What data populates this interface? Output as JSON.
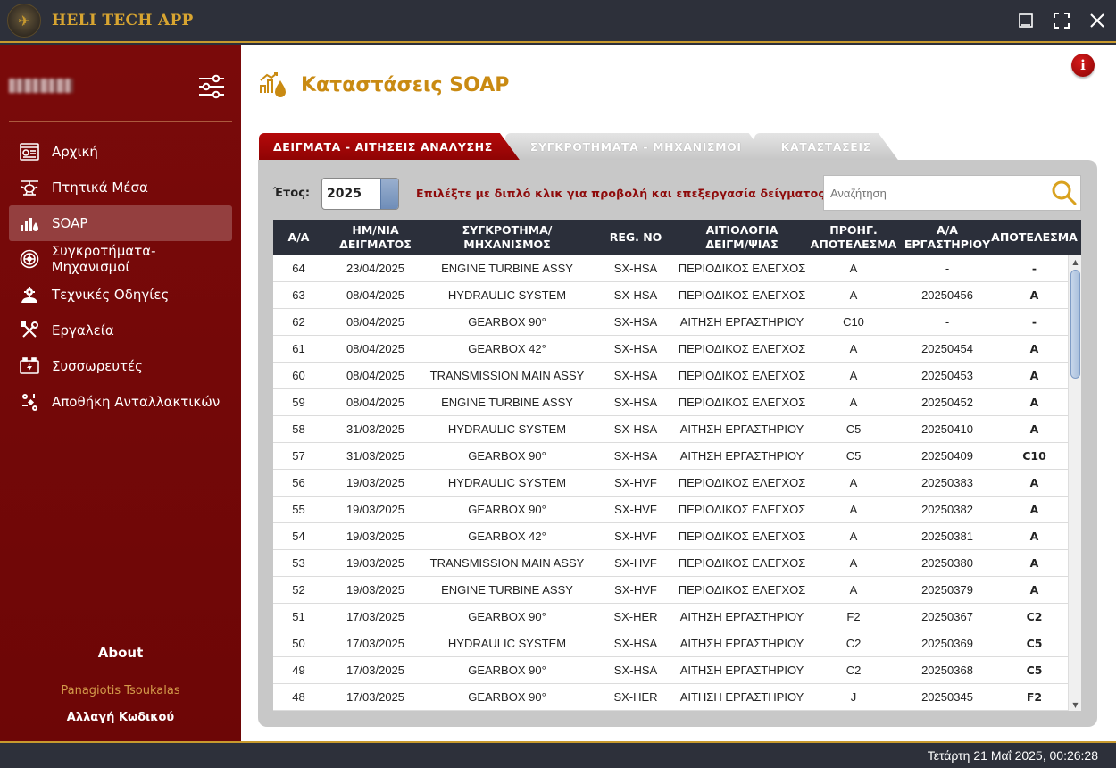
{
  "app": {
    "title": "HELI TECH APP"
  },
  "sidebar": {
    "items": [
      {
        "label": "Αρχική",
        "icon": "dashboard-icon"
      },
      {
        "label": "Πτητικά Μέσα",
        "icon": "helicopter-icon"
      },
      {
        "label": "SOAP",
        "icon": "oil-analysis-icon",
        "active": true
      },
      {
        "label": "Συγκροτήματα-Μηχανισμοί",
        "icon": "turbine-icon"
      },
      {
        "label": "Τεχνικές Οδηγίες",
        "icon": "gear-person-icon"
      },
      {
        "label": "Εργαλεία",
        "icon": "tools-icon"
      },
      {
        "label": "Συσσωρευτές",
        "icon": "battery-icon"
      },
      {
        "label": "Αποθήκη Ανταλλακτικών",
        "icon": "warehouse-parts-icon"
      }
    ],
    "about": "About",
    "user_name": "Panagiotis Tsoukalas",
    "change_password": "Αλλαγή Κωδικού"
  },
  "page": {
    "title": "Καταστάσεις SOAP",
    "tabs": [
      {
        "label": "ΔΕΙΓΜΑΤΑ - ΑΙΤΗΣΕΙΣ ΑΝΑΛΥΣΗΣ",
        "active": true
      },
      {
        "label": "ΣΥΓΚΡΟΤΗΜΑΤΑ - ΜΗΧΑΝΙΣΜΟΙ",
        "active": false
      },
      {
        "label": "ΚΑΤΑΣΤΑΣΕΙΣ",
        "active": false
      }
    ],
    "year_label": "Έτος:",
    "year_value": "2025",
    "hint": "Επιλέξτε με διπλό κλικ για προβολή και επεξεργασία δείγματος.",
    "search_placeholder": "Αναζήτηση"
  },
  "table": {
    "headers": [
      "Α/Α",
      "ΗΜ/ΝΙΑ\nΔΕΙΓΜΑΤΟΣ",
      "ΣΥΓΚΡΟΤΗΜΑ/\nΜΗΧΑΝΙΣΜΟΣ",
      "REG. NO",
      "ΑΙΤΙΟΛΟΓΙΑ\nΔΕΙΓΜ/ΨΙΑΣ",
      "ΠΡΟΗΓ.\nΑΠΟΤΕΛΕΣΜΑ",
      "Α/Α\nΕΡΓΑΣΤΗΡΙΟΥ",
      "ΑΠΟΤΕΛΕΣΜΑ"
    ],
    "rows": [
      [
        "64",
        "23/04/2025",
        "ENGINE TURBINE ASSY",
        "SX-HSA",
        "ΠΕΡΙΟΔΙΚΟΣ ΕΛΕΓΧΟΣ",
        "A",
        "-",
        "-"
      ],
      [
        "63",
        "08/04/2025",
        "HYDRAULIC SYSTEM",
        "SX-HSA",
        "ΠΕΡΙΟΔΙΚΟΣ ΕΛΕΓΧΟΣ",
        "A",
        "20250456",
        "A"
      ],
      [
        "62",
        "08/04/2025",
        "GEARBOX 90°",
        "SX-HSA",
        "ΑΙΤΗΣΗ ΕΡΓΑΣΤΗΡΙΟΥ",
        "C10",
        "-",
        "-"
      ],
      [
        "61",
        "08/04/2025",
        "GEARBOX 42°",
        "SX-HSA",
        "ΠΕΡΙΟΔΙΚΟΣ ΕΛΕΓΧΟΣ",
        "A",
        "20250454",
        "A"
      ],
      [
        "60",
        "08/04/2025",
        "TRANSMISSION MAIN ASSY",
        "SX-HSA",
        "ΠΕΡΙΟΔΙΚΟΣ ΕΛΕΓΧΟΣ",
        "A",
        "20250453",
        "A"
      ],
      [
        "59",
        "08/04/2025",
        "ENGINE TURBINE ASSY",
        "SX-HSA",
        "ΠΕΡΙΟΔΙΚΟΣ ΕΛΕΓΧΟΣ",
        "A",
        "20250452",
        "A"
      ],
      [
        "58",
        "31/03/2025",
        "HYDRAULIC SYSTEM",
        "SX-HSA",
        "ΑΙΤΗΣΗ ΕΡΓΑΣΤΗΡΙΟΥ",
        "C5",
        "20250410",
        "A"
      ],
      [
        "57",
        "31/03/2025",
        "GEARBOX 90°",
        "SX-HSA",
        "ΑΙΤΗΣΗ ΕΡΓΑΣΤΗΡΙΟΥ",
        "C5",
        "20250409",
        "C10"
      ],
      [
        "56",
        "19/03/2025",
        "HYDRAULIC SYSTEM",
        "SX-HVF",
        "ΠΕΡΙΟΔΙΚΟΣ ΕΛΕΓΧΟΣ",
        "A",
        "20250383",
        "A"
      ],
      [
        "55",
        "19/03/2025",
        "GEARBOX 90°",
        "SX-HVF",
        "ΠΕΡΙΟΔΙΚΟΣ ΕΛΕΓΧΟΣ",
        "A",
        "20250382",
        "A"
      ],
      [
        "54",
        "19/03/2025",
        "GEARBOX 42°",
        "SX-HVF",
        "ΠΕΡΙΟΔΙΚΟΣ ΕΛΕΓΧΟΣ",
        "A",
        "20250381",
        "A"
      ],
      [
        "53",
        "19/03/2025",
        "TRANSMISSION MAIN ASSY",
        "SX-HVF",
        "ΠΕΡΙΟΔΙΚΟΣ ΕΛΕΓΧΟΣ",
        "A",
        "20250380",
        "A"
      ],
      [
        "52",
        "19/03/2025",
        "ENGINE TURBINE ASSY",
        "SX-HVF",
        "ΠΕΡΙΟΔΙΚΟΣ ΕΛΕΓΧΟΣ",
        "A",
        "20250379",
        "A"
      ],
      [
        "51",
        "17/03/2025",
        "GEARBOX 90°",
        "SX-HER",
        "ΑΙΤΗΣΗ ΕΡΓΑΣΤΗΡΙΟΥ",
        "F2",
        "20250367",
        "C2"
      ],
      [
        "50",
        "17/03/2025",
        "HYDRAULIC SYSTEM",
        "SX-HSA",
        "ΑΙΤΗΣΗ ΕΡΓΑΣΤΗΡΙΟΥ",
        "C2",
        "20250369",
        "C5"
      ],
      [
        "49",
        "17/03/2025",
        "GEARBOX 90°",
        "SX-HSA",
        "ΑΙΤΗΣΗ ΕΡΓΑΣΤΗΡΙΟΥ",
        "C2",
        "20250368",
        "C5"
      ],
      [
        "48",
        "17/03/2025",
        "GEARBOX 90°",
        "SX-HER",
        "ΑΙΤΗΣΗ ΕΡΓΑΣΤΗΡΙΟΥ",
        "J",
        "20250345",
        "F2"
      ]
    ]
  },
  "status": {
    "datetime": "Τετάρτη 21 Μαΐ 2025, 00:26:28"
  },
  "colors": {
    "accent_gold": "#c98a12",
    "sidebar_red": "#7a0a0a",
    "dark_bar": "#2d303a",
    "tab_red": "#a00707"
  }
}
